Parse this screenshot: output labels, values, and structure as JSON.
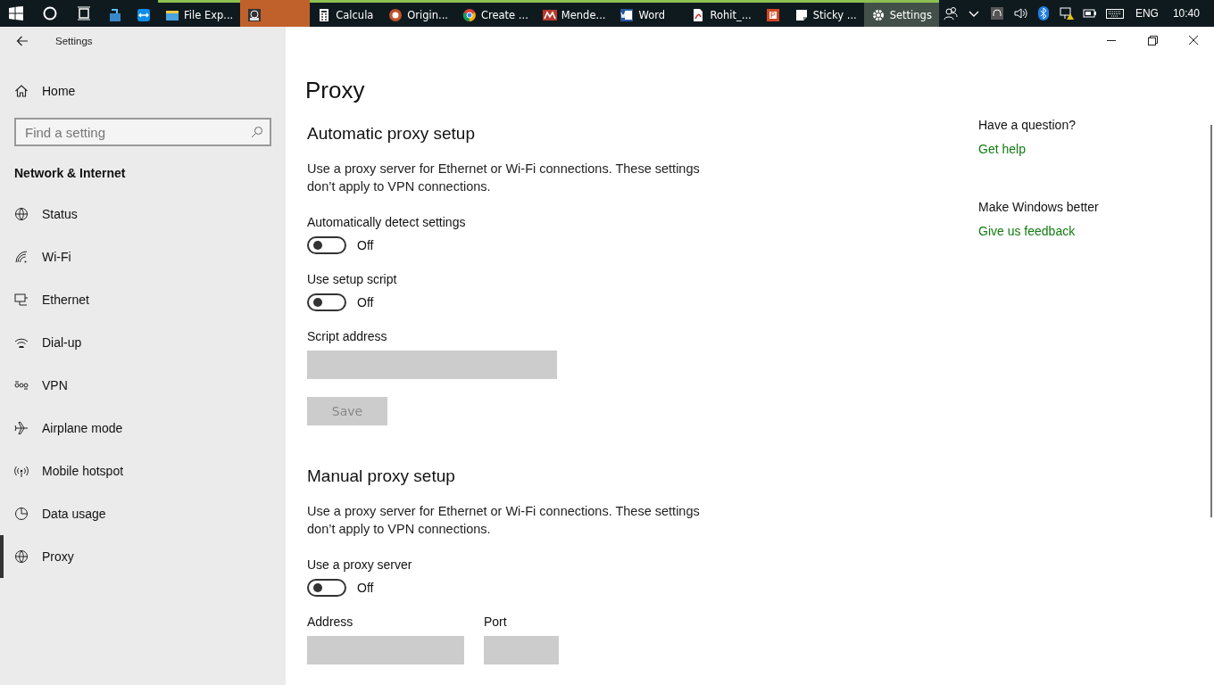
{
  "taskbar": {
    "apps": [
      {
        "running": false,
        "selected": false,
        "flashing": false
      },
      {
        "running": false,
        "selected": false,
        "flashing": false
      },
      {
        "label": "File Exp...",
        "running": true,
        "selected": false,
        "flashing": false
      },
      {
        "running": false,
        "selected": false,
        "flashing": true
      },
      {
        "label": "Calcula",
        "running": true,
        "selected": false,
        "flashing": false
      },
      {
        "label": "Origin...",
        "running": true,
        "selected": false,
        "flashing": false
      },
      {
        "label": "Create ...",
        "running": true,
        "selected": false,
        "flashing": false
      },
      {
        "label": "Mende...",
        "running": true,
        "selected": false,
        "flashing": false
      },
      {
        "label": "Word",
        "running": true,
        "selected": false,
        "flashing": false
      },
      {
        "label": "Rohit_...",
        "running": true,
        "selected": false,
        "flashing": false
      },
      {
        "running": true,
        "selected": false,
        "flashing": false
      },
      {
        "label": "Sticky ...",
        "running": true,
        "selected": false,
        "flashing": false
      },
      {
        "label": "Settings",
        "running": true,
        "selected": true,
        "flashing": false
      }
    ],
    "language": "ENG",
    "time": "10:40"
  },
  "window": {
    "title": "Settings"
  },
  "sidebar": {
    "home": "Home",
    "search": {
      "placeholder": "Find a setting"
    },
    "heading": "Network & Internet",
    "items": [
      {
        "label": "Status",
        "selected": false
      },
      {
        "label": "Wi-Fi",
        "selected": false
      },
      {
        "label": "Ethernet",
        "selected": false
      },
      {
        "label": "Dial-up",
        "selected": false
      },
      {
        "label": "VPN",
        "selected": false
      },
      {
        "label": "Airplane mode",
        "selected": false
      },
      {
        "label": "Mobile hotspot",
        "selected": false
      },
      {
        "label": "Data usage",
        "selected": false
      },
      {
        "label": "Proxy",
        "selected": true
      }
    ]
  },
  "page": {
    "title": "Proxy",
    "sections": [
      {
        "heading": "Automatic proxy setup",
        "description": "Use a proxy server for Ethernet or Wi-Fi connections. These settings don’t apply to VPN connections.",
        "items": [
          {
            "kind": "toggle",
            "label": "Automatically detect settings",
            "on": false,
            "state_text": "Off"
          },
          {
            "kind": "toggle",
            "label": "Use setup script",
            "on": false,
            "state_text": "Off"
          },
          {
            "kind": "field",
            "label": "Script address",
            "disabled": true
          },
          {
            "kind": "button",
            "label": "Save",
            "disabled": true
          }
        ]
      },
      {
        "heading": "Manual proxy setup",
        "description": "Use a proxy server for Ethernet or Wi-Fi connections. These settings don’t apply to VPN connections.",
        "items": [
          {
            "kind": "toggle",
            "label": "Use a proxy server",
            "on": false,
            "state_text": "Off"
          },
          {
            "kind": "fieldpair",
            "fields": [
              {
                "label": "Address",
                "disabled": true
              },
              {
                "label": "Port",
                "disabled": true
              }
            ]
          }
        ]
      }
    ]
  },
  "aside": [
    {
      "heading": "Have a question?",
      "link": "Get help"
    },
    {
      "heading": "Make Windows better",
      "link": "Give us feedback"
    }
  ]
}
